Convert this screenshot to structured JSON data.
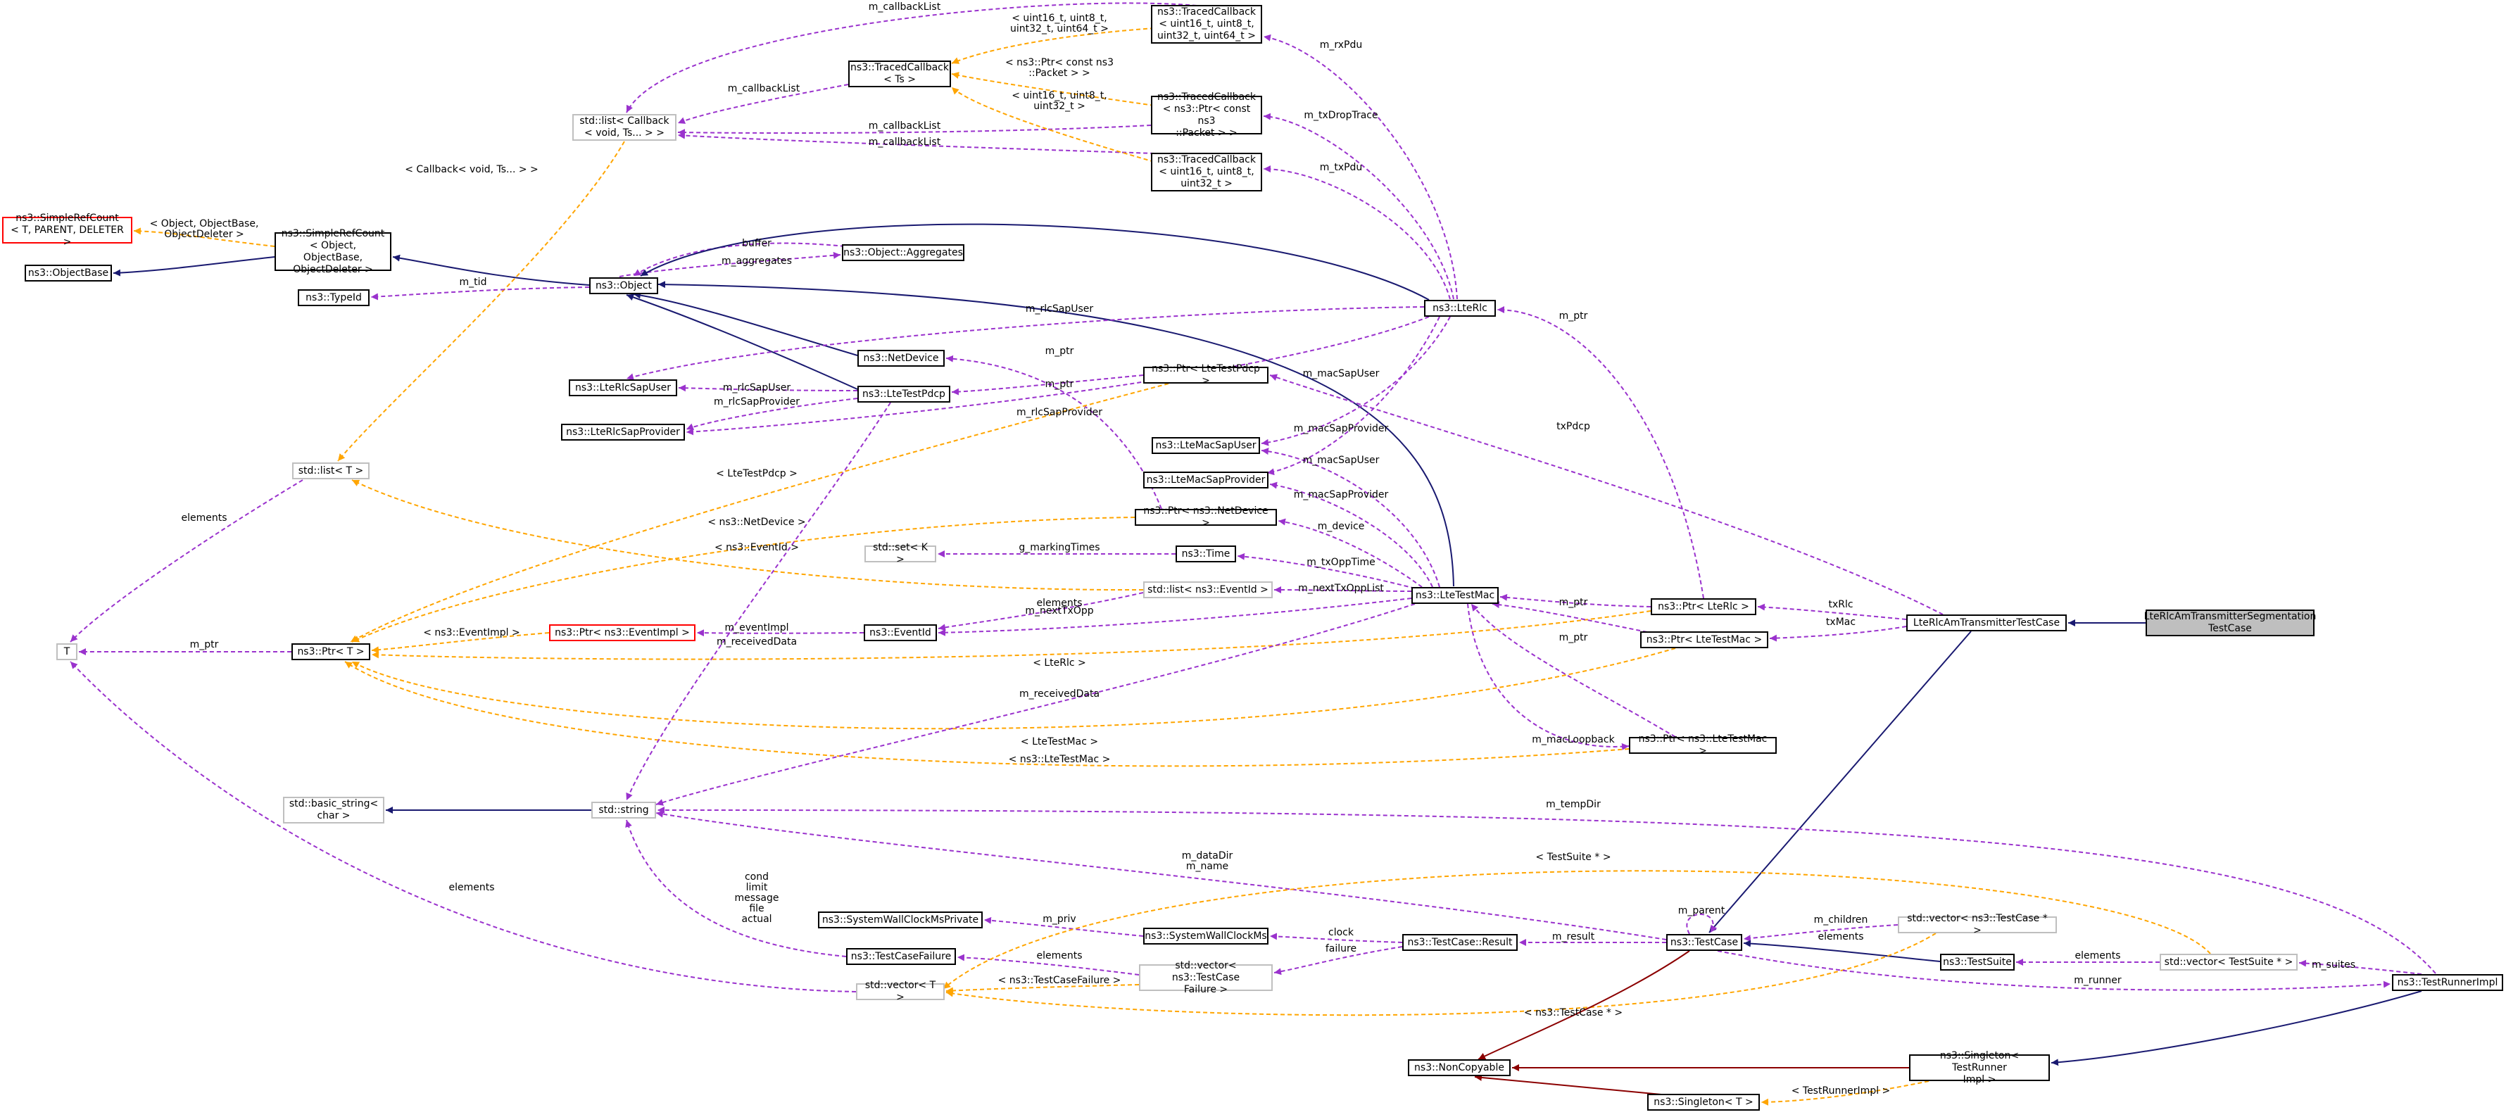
{
  "nodes": {
    "lte_rlc_am_tx_seg": "LteRlcAmTransmitterSegmentation\nTestCase",
    "lte_rlc_am_tx_testcase": "LteRlcAmTransmitterTestCase",
    "traced_cb_rxpdu": "ns3::TracedCallback\n< uint16_t, uint8_t,\n uint32_t, uint64_t >",
    "traced_cb_ts": "ns3::TracedCallback\n< Ts >",
    "traced_cb_packet": "ns3::TracedCallback\n< ns3::Ptr< const ns3\n::Packet > >",
    "traced_cb_txpdu": "ns3::TracedCallback\n< uint16_t, uint8_t,\n uint32_t >",
    "std_list_callback": "std::list< Callback\n< void, Ts... > >",
    "simple_ref_count_t": "ns3::SimpleRefCount\n< T, PARENT, DELETER >",
    "simple_ref_count_obj": "ns3::SimpleRefCount\n< Object, ObjectBase,\n ObjectDeleter >",
    "object_base": "ns3::ObjectBase",
    "object": "ns3::Object",
    "object_aggregates": "ns3::Object::Aggregates",
    "type_id": "ns3::TypeId",
    "lte_rlc": "ns3::LteRlc",
    "net_device": "ns3::NetDevice",
    "lte_rlc_sap_user": "ns3::LteRlcSapUser",
    "lte_test_pdcp": "ns3::LteTestPdcp",
    "lte_rlc_sap_provider": "ns3::LteRlcSapProvider",
    "ptr_lte_test_pdcp": "ns3::Ptr< LteTestPdcp >",
    "lte_mac_sap_user": "ns3::LteMacSapUser",
    "lte_mac_sap_provider": "ns3::LteMacSapProvider",
    "std_list_t": "std::list< T >",
    "ptr_net_device": "ns3::Ptr< ns3::NetDevice >",
    "std_set_k": "std::set< K >",
    "time": "ns3::Time",
    "std_list_eventid": "std::list< ns3::EventId >",
    "lte_test_mac": "ns3::LteTestMac",
    "t": "T",
    "ptr_t": "ns3::Ptr< T >",
    "ptr_event_impl": "ns3::Ptr< ns3::EventImpl >",
    "event_id": "ns3::EventId",
    "ptr_lte_rlc": "ns3::Ptr< LteRlc >",
    "ptr_lte_test_mac": "ns3::Ptr< LteTestMac >",
    "ptr_ns3_lte_test_mac": "ns3::Ptr< ns3::LteTestMac >",
    "basic_string": "std::basic_string<\n char >",
    "std_string": "std::string",
    "system_wall_clock_ms_private": "ns3::SystemWallClockMsPrivate",
    "system_wall_clock_ms": "ns3::SystemWallClockMs",
    "test_case_result": "ns3::TestCase::Result",
    "test_case_failure": "ns3::TestCaseFailure",
    "std_vector_failure": "std::vector< ns3::TestCase\nFailure >",
    "std_vector_t": "std::vector< T >",
    "test_case": "ns3::TestCase",
    "std_vector_testcase": "std::vector< ns3::TestCase * >",
    "test_suite": "ns3::TestSuite",
    "std_vector_testsuite": "std::vector< TestSuite * >",
    "test_runner_impl": "ns3::TestRunnerImpl",
    "non_copyable": "ns3::NonCopyable",
    "singleton_runner": "ns3::Singleton< TestRunner\nImpl >",
    "singleton_t": "ns3::Singleton< T >"
  },
  "edge_labels": {
    "callback_list_top": "m_callbackList",
    "rxpdu": "m_rxPdu",
    "tpl_rx": "< uint16_t, uint8_t,\nuint32_t, uint64_t >",
    "tpl_packet": "< ns3::Ptr< const ns3\n::Packet > >",
    "tpl_tx": "< uint16_t, uint8_t,\nuint32_t >",
    "callback_list_ts": "m_callbackList",
    "callback_list_packet": "m_callbackList",
    "callback_list_tx": "m_callbackList",
    "tx_drop_trace": "m_txDropTrace",
    "txpdu": "m_txPdu",
    "tpl_callback": "< Callback< void, Ts... > >",
    "tpl_simple_ref": "< Object, ObjectBase,\nObjectDeleter >",
    "buffer": "buffer",
    "aggregates": "m_aggregates",
    "tid": "m_tid",
    "rlc_sap_user": "m_rlcSapUser",
    "rlc_sap_user_pdcp": "m_rlcSapUser",
    "rlc_sap_provider": "m_rlcSapProvider",
    "rlc_sap_provider_pdcp": "m_rlcSapProvider",
    "ptr_net": "m_ptr",
    "ptr_pdcp": "m_ptr",
    "ptr_rlc": "m_ptr",
    "mac_sap_user_rlc": "m_macSapUser",
    "mac_sap_provider_rlc": "m_macSapProvider",
    "mac_sap_user_mac": "m_macSapUser",
    "mac_sap_provider_mac": "m_macSapProvider",
    "device": "m_device",
    "tx_opp_time": "m_txOppTime",
    "next_tx_opp_list": "m_nextTxOppList",
    "next_tx_opp": "m_nextTxOpp",
    "elements_list_t": "elements",
    "elements_list_eventid": "elements",
    "tpl_test_pdcp": "< LteTestPdcp >",
    "tpl_net_device": "< ns3::NetDevice >",
    "tpl_event_id": "< ns3::EventId >",
    "marking_times": "g_markingTimes",
    "ptr_t_label": "m_ptr",
    "tpl_event_impl": "< ns3::EventImpl >",
    "event_impl": "m_eventImpl",
    "tpl_lte_rlc": "< LteRlc >",
    "tpl_lte_test_mac": "< LteTestMac >",
    "tpl_ns3_lte_test_mac": "< ns3::LteTestMac >",
    "received_data_pdcp": "m_receivedData",
    "received_data_mac": "m_receivedData",
    "ptr_mac_a": "m_ptr",
    "ptr_mac_b": "m_ptr",
    "mac_loopback": "m_macLoopback",
    "tx_rlc": "txRlc",
    "tx_mac": "txMac",
    "tx_pdcp": "txPdcp",
    "temp_dir": "m_tempDir",
    "data_dir": "m_dataDir\nm_name",
    "failure_fields": "cond\nlimit\nmessage\nfile\nactual",
    "elements_vector_t": "elements",
    "priv": "m_priv",
    "clock": "clock",
    "failure": "failure",
    "elements_failure": "elements",
    "tpl_test_case_failure": "< ns3::TestCaseFailure >",
    "result": "m_result",
    "parent": "m_parent",
    "children": "m_children",
    "elements_testcase": "elements",
    "elements_suites": "elements",
    "suites": "m_suites",
    "runner": "m_runner",
    "tpl_test_case_ptr": "< ns3::TestCase * >",
    "tpl_test_suite_ptr": "< TestSuite * >",
    "tpl_runner_impl": "< TestRunnerImpl >"
  },
  "colors": {
    "inheritance": "#191970",
    "private_inheritance": "#8b0000",
    "usage": "#9a32cd",
    "template": "#ffa500"
  }
}
